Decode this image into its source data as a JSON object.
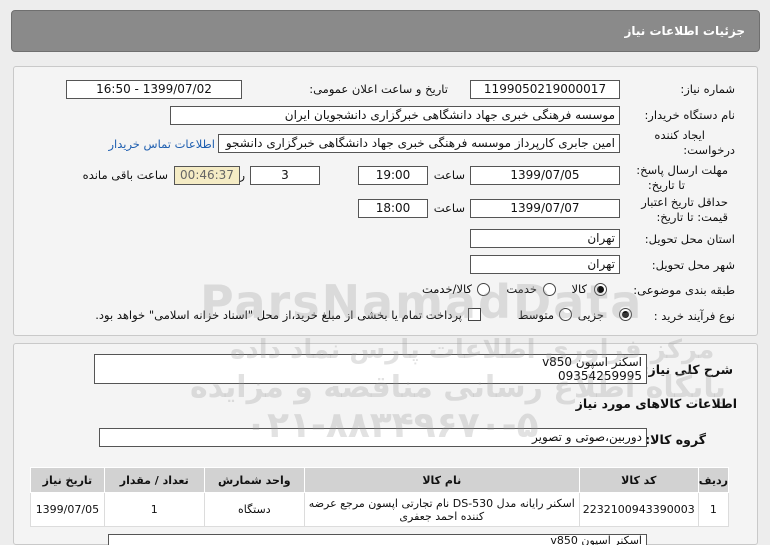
{
  "window": {
    "title": "جزئیات اطلاعات نیاز"
  },
  "fields": {
    "need_number_label": "شماره نیاز:",
    "need_number": "1199050219000017",
    "announce_label": "تاریخ و ساعت اعلان عمومی:",
    "announce_value": "1399/07/02 - 16:50",
    "buyer_label": "نام دستگاه خریدار:",
    "buyer_value": "موسسه فرهنگی خبری جهاد دانشگاهی خبرگزاری دانشجویان ایران",
    "creator_label_1": "ایجاد کننده",
    "creator_label_2": "درخواست:",
    "creator_value": "امین جابری کارپرداز موسسه فرهنگی خبری جهاد دانشگاهی خبرگزاری دانشجو",
    "contact_link": "اطلاعات تماس خریدار",
    "send_label_1": "مهلت ارسال پاسخ:",
    "send_label_2": "تا تاریخ:",
    "send_date": "1399/07/05",
    "time_label": "ساعت",
    "send_time": "19:00",
    "days_value": "3",
    "days_label": "روز و",
    "remaining_timer": "00:46:37",
    "remaining_label": "ساعت باقی مانده",
    "validity_label_1": "حداقل تاریخ اعتبار",
    "validity_label_2": "قیمت: تا تاریخ:",
    "validity_date": "1399/07/07",
    "validity_time": "18:00",
    "province_label": "استان محل تحویل:",
    "province_value": "تهران",
    "city_label": "شهر محل تحویل:",
    "city_value": "تهران",
    "category_label": "طبقه بندی موضوعی:",
    "category_options": [
      "کالا",
      "خدمت",
      "کالا/خدمت"
    ],
    "category_selected": "کالا",
    "purchase_type_label": "نوع فرآیند خرید :",
    "purchase_options": [
      "جزیی",
      "متوسط"
    ],
    "purchase_selected": "جزیی",
    "payment_note": "پرداخت تمام یا بخشی از مبلغ خرید،از محل \"اسناد خزانه اسلامی\" خواهد بود."
  },
  "summary": {
    "label": "شرح کلی نیاز:",
    "line1": "اسکنر اسپون v850",
    "line2": "09354259995"
  },
  "goods_info": {
    "title": "اطلاعات کالاهای مورد نیاز",
    "group_label": "گروه کالا:",
    "group_value": "دوربین،صوتی و تصویر"
  },
  "table": {
    "headers": [
      "ردیف",
      "کد کالا",
      "نام کالا",
      "واحد شمارش",
      "تعداد / مقدار",
      "تاریخ نیاز"
    ],
    "rows": [
      {
        "row": "1",
        "code": "2232100943390003",
        "name": "اسکنر رایانه مدل DS-530 نام تجارتی اپسون مرجع عرضه کننده احمد جعفری",
        "unit": "دستگاه",
        "qty": "1",
        "date": "1399/07/05"
      }
    ]
  },
  "bottom_box_text": "اسکنر اسپون v850",
  "watermark": {
    "line1": "ParsNamadData",
    "line2": "مرکز فراوری اطلاعات پارس نماد داده",
    "line3": "پایگاه اطلاع رسانی مناقصه و مزایده",
    "line4": "۰۲۱-۸۸۳۴۹۶۷۰-۵"
  },
  "colors": {
    "titlebar": "#8a8a8a",
    "link": "#1f5fb0",
    "timer_bg": "#f5ecc5",
    "table_header": "#d2d2d2"
  }
}
